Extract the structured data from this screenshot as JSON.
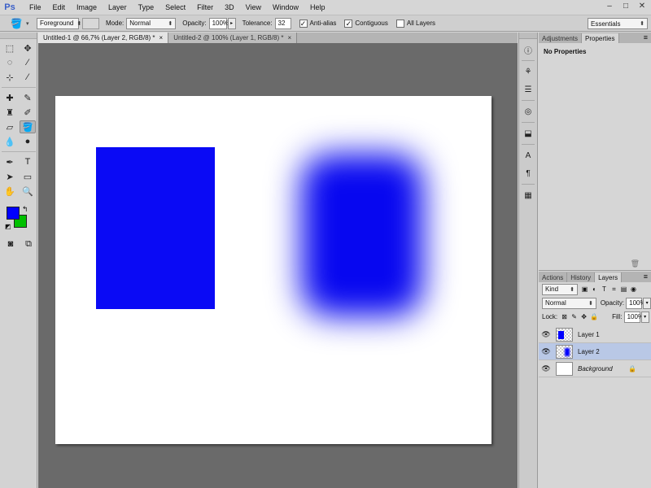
{
  "app": {
    "logo": "Ps"
  },
  "menu": [
    "File",
    "Edit",
    "Image",
    "Layer",
    "Type",
    "Select",
    "Filter",
    "3D",
    "View",
    "Window",
    "Help"
  ],
  "window_controls": [
    "–",
    "□",
    "✕"
  ],
  "options": {
    "fill_source": "Foreground",
    "mode_label": "Mode:",
    "mode_value": "Normal",
    "opacity_label": "Opacity:",
    "opacity_value": "100%",
    "tolerance_label": "Tolerance:",
    "tolerance_value": "32",
    "antialias_label": "Anti-alias",
    "contiguous_label": "Contiguous",
    "all_layers_label": "All Layers",
    "workspace": "Essentials"
  },
  "doc_tabs": [
    {
      "label": "Untitled-1 @ 66,7% (Layer 2, RGB/8) *",
      "close": "×"
    },
    {
      "label": "Untitled-2 @ 100% (Layer 1, RGB/8) *",
      "close": "×"
    }
  ],
  "colors": {
    "foreground": "#0000ff",
    "background": "#00c000",
    "canvas": "#ffffff",
    "workspace": "#6a6a6a"
  },
  "properties_panel": {
    "tabs": [
      "Adjustments",
      "Properties"
    ],
    "title": "No Properties"
  },
  "layers_panel": {
    "tabs": [
      "Actions",
      "History",
      "Layers"
    ],
    "kind_label": "Kind",
    "blend_mode": "Normal",
    "opacity_label": "Opacity:",
    "opacity_value": "100%",
    "lock_label": "Lock:",
    "fill_label": "Fill:",
    "fill_value": "100%",
    "layers": [
      {
        "name": "Layer 1",
        "selected": false
      },
      {
        "name": "Layer 2",
        "selected": true
      },
      {
        "name": "Background",
        "selected": false,
        "locked": true
      }
    ]
  }
}
